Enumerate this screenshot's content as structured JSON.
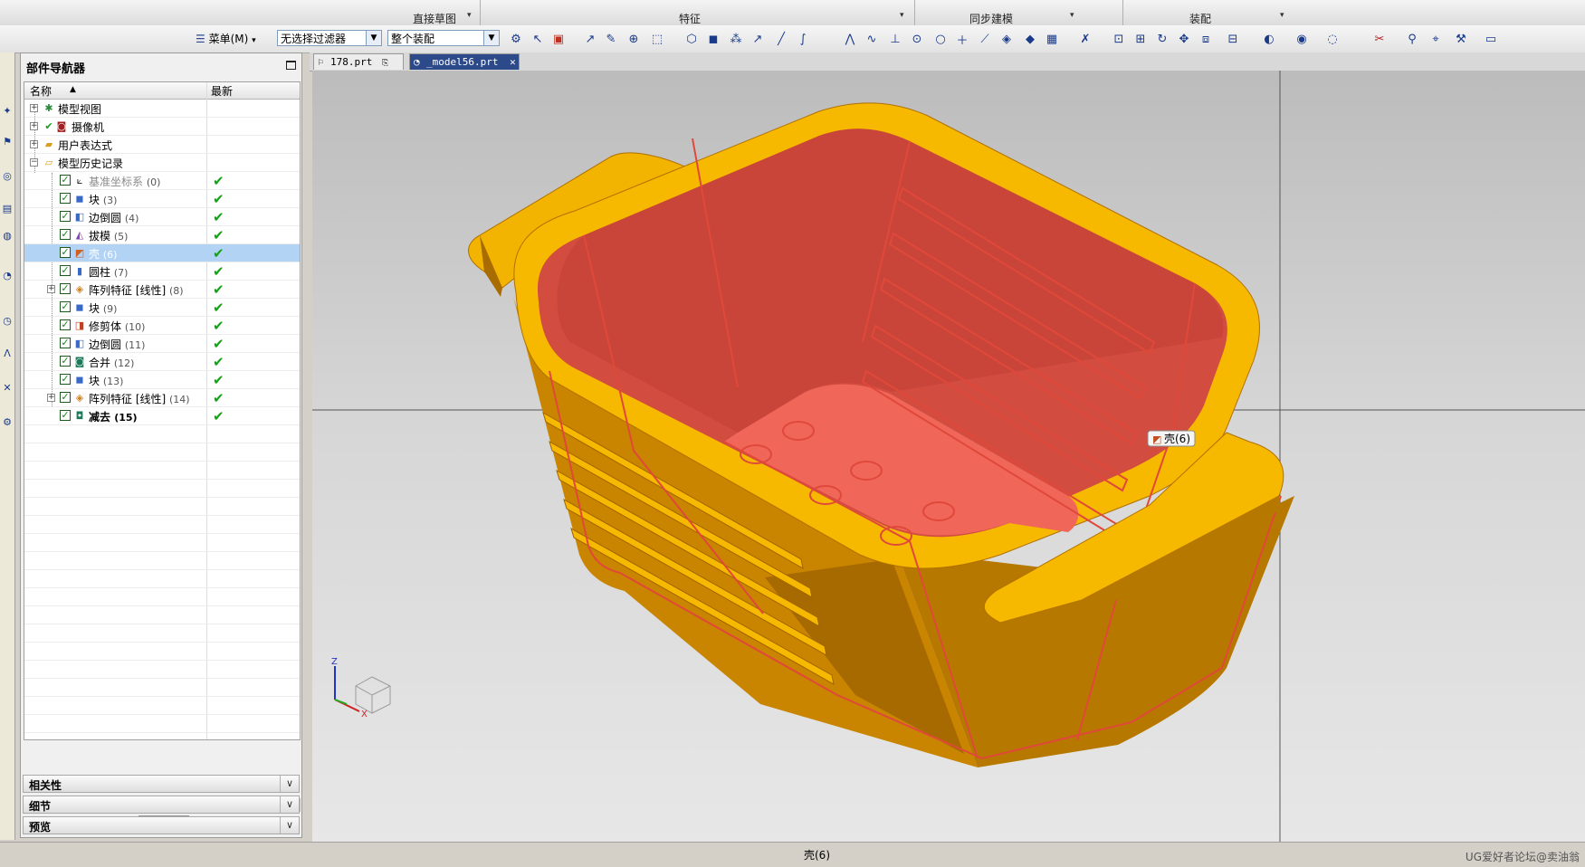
{
  "ribbon": {
    "groups": [
      "直接草图",
      "特征",
      "同步建模",
      "装配"
    ]
  },
  "toolbar": {
    "menu_label": "菜单(M)",
    "filter_value": "无选择过滤器",
    "scope_value": "整个装配"
  },
  "navigator": {
    "title": "部件导航器",
    "col_name": "名称",
    "col_latest": "最新",
    "top_nodes": [
      {
        "label": "模型视图"
      },
      {
        "label": "摄像机"
      },
      {
        "label": "用户表达式"
      },
      {
        "label": "模型历史记录"
      }
    ],
    "features": [
      {
        "label": "基准坐标系",
        "num": "(0)"
      },
      {
        "label": "块",
        "num": "(3)"
      },
      {
        "label": "边倒圆",
        "num": "(4)"
      },
      {
        "label": "拔模",
        "num": "(5)"
      },
      {
        "label": "壳",
        "num": "(6)"
      },
      {
        "label": "圆柱",
        "num": "(7)"
      },
      {
        "label": "阵列特征 [线性]",
        "num": "(8)"
      },
      {
        "label": "块",
        "num": "(9)"
      },
      {
        "label": "修剪体",
        "num": "(10)"
      },
      {
        "label": "边倒圆",
        "num": "(11)"
      },
      {
        "label": "合并",
        "num": "(12)"
      },
      {
        "label": "块",
        "num": "(13)"
      },
      {
        "label": "阵列特征 [线性]",
        "num": "(14)"
      },
      {
        "label": "减去",
        "num": "(15)"
      }
    ],
    "sections": [
      "相关性",
      "细节",
      "预览"
    ]
  },
  "tabs": [
    {
      "label": "178.prt"
    },
    {
      "label": "_model56.prt"
    }
  ],
  "viewport": {
    "tooltip": "壳(6)",
    "axis_z": "Z",
    "axis_x": "X",
    "colors": {
      "body": "#f2b400",
      "face": "#f06050",
      "edge": "#e0483a"
    }
  },
  "status": {
    "text": "壳(6)",
    "watermark": "UG爱好者论坛@卖油翁"
  }
}
